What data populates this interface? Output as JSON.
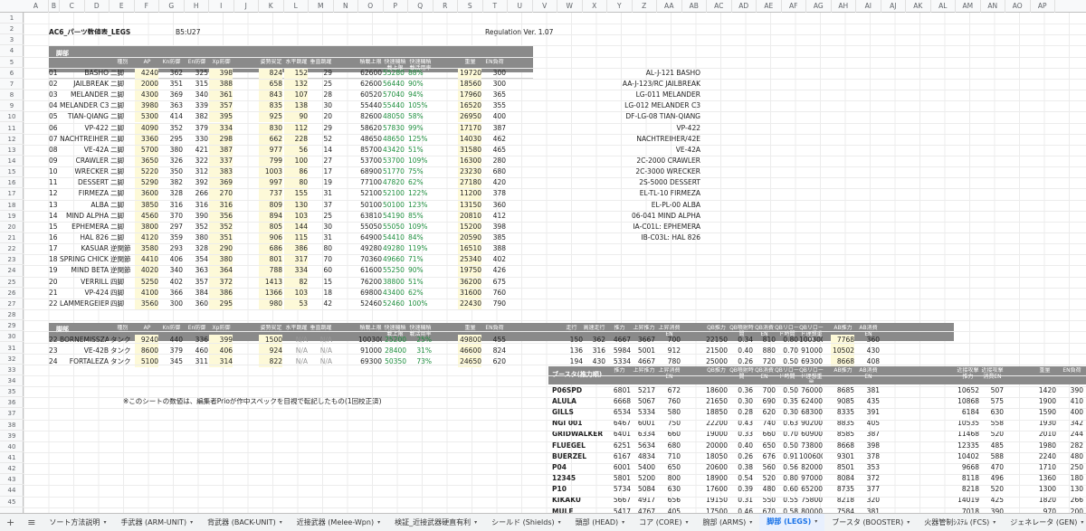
{
  "columns": [
    "A",
    "B",
    "C",
    "D",
    "E",
    "F",
    "G",
    "H",
    "I",
    "J",
    "K",
    "L",
    "M",
    "N",
    "O",
    "P",
    "Q",
    "R",
    "S",
    "T",
    "U",
    "V",
    "W",
    "X",
    "Y",
    "Z",
    "AA",
    "AB",
    "AC",
    "AD",
    "AE",
    "AF",
    "AG",
    "AH",
    "AI",
    "AJ",
    "AK",
    "AL",
    "AM",
    "AN",
    "AO",
    "AP"
  ],
  "rows": [
    "1",
    "2",
    "3",
    "4",
    "5",
    "6",
    "7",
    "8",
    "9",
    "10",
    "11",
    "12",
    "13",
    "14",
    "15",
    "16",
    "17",
    "18",
    "19",
    "20",
    "21",
    "22",
    "23",
    "24",
    "25",
    "26",
    "27",
    "28",
    "29",
    "30",
    "31",
    "32",
    "33",
    "34",
    "35",
    "36",
    "37",
    "38",
    "39",
    "40",
    "41",
    "42",
    "43",
    "44",
    "45"
  ],
  "title": "AC6_パーツ数値表_LEGS",
  "range": "B5:U27",
  "regulation": "Regulation Ver. 1.07",
  "section1": {
    "label": "脚部",
    "headers": [
      "種別",
      "AP",
      "Kn防御",
      "En防御",
      "Xp防御",
      "姿勢安定",
      "水平跳躍",
      "垂直跳躍",
      "積載上限",
      "快速機積載上限",
      "快速機積載活用率",
      "重量",
      "EN負荷"
    ]
  },
  "legs": [
    [
      "01",
      "BASHO",
      "二脚",
      "4240",
      "362",
      "325",
      "398",
      "824",
      "152",
      "29",
      "62600",
      "55280",
      "88%",
      "19720",
      "300",
      "AL-J-121 BASHO"
    ],
    [
      "02",
      "JAILBREAK",
      "二脚",
      "2000",
      "351",
      "315",
      "388",
      "658",
      "132",
      "25",
      "62600",
      "56440",
      "90%",
      "18560",
      "300",
      "AA-J-123/RC JAILBREAK"
    ],
    [
      "03",
      "MELANDER",
      "二脚",
      "4300",
      "369",
      "340",
      "361",
      "843",
      "107",
      "28",
      "60520",
      "57040",
      "94%",
      "17960",
      "365",
      "LG-011 MELANDER"
    ],
    [
      "04",
      "MELANDER C3",
      "二脚",
      "3980",
      "363",
      "339",
      "357",
      "835",
      "138",
      "30",
      "55440",
      "55440",
      "105%",
      "16520",
      "355",
      "LG-012 MELANDER C3"
    ],
    [
      "05",
      "TIAN-QIANG",
      "二脚",
      "5300",
      "414",
      "382",
      "395",
      "925",
      "90",
      "20",
      "82600",
      "48050",
      "58%",
      "26950",
      "400",
      "DF-LG-08 TIAN-QIANG"
    ],
    [
      "06",
      "VP-422",
      "二脚",
      "4090",
      "352",
      "379",
      "334",
      "830",
      "112",
      "29",
      "58620",
      "57830",
      "99%",
      "17170",
      "387",
      "VP-422"
    ],
    [
      "07",
      "NACHTREIHER",
      "二脚",
      "3360",
      "295",
      "330",
      "298",
      "662",
      "228",
      "52",
      "48650",
      "48650",
      "125%",
      "14030",
      "462",
      "NACHTREIHER/42E"
    ],
    [
      "08",
      "VE-42A",
      "二脚",
      "5700",
      "380",
      "421",
      "387",
      "977",
      "56",
      "14",
      "85700",
      "43420",
      "51%",
      "31580",
      "465",
      "VE-42A"
    ],
    [
      "09",
      "CRAWLER",
      "二脚",
      "3650",
      "326",
      "322",
      "337",
      "799",
      "100",
      "27",
      "53700",
      "53700",
      "109%",
      "16300",
      "280",
      "2C-2000 CRAWLER"
    ],
    [
      "10",
      "WRECKER",
      "二脚",
      "5220",
      "350",
      "312",
      "383",
      "1003",
      "86",
      "17",
      "68900",
      "51770",
      "75%",
      "23230",
      "680",
      "2C-3000 WRECKER"
    ],
    [
      "11",
      "DESSERT",
      "二脚",
      "5290",
      "382",
      "392",
      "369",
      "997",
      "80",
      "19",
      "77100",
      "47820",
      "62%",
      "27180",
      "420",
      "2S-5000 DESSERT"
    ],
    [
      "12",
      "FIRMEZA",
      "二脚",
      "3600",
      "328",
      "266",
      "270",
      "737",
      "155",
      "31",
      "52100",
      "52100",
      "122%",
      "11200",
      "378",
      "EL-TL-10 FIRMEZA"
    ],
    [
      "13",
      "ALBA",
      "二脚",
      "3850",
      "316",
      "316",
      "316",
      "809",
      "130",
      "37",
      "50100",
      "50100",
      "123%",
      "13150",
      "360",
      "EL-PL-00 ALBA"
    ],
    [
      "14",
      "MIND ALPHA",
      "二脚",
      "4560",
      "370",
      "390",
      "356",
      "894",
      "103",
      "25",
      "63810",
      "54190",
      "85%",
      "20810",
      "412",
      "06-041 MIND ALPHA"
    ],
    [
      "15",
      "EPHEMERA",
      "二脚",
      "3800",
      "297",
      "352",
      "352",
      "805",
      "144",
      "30",
      "55050",
      "55050",
      "109%",
      "15200",
      "398",
      "IA-C01L: EPHEMERA"
    ],
    [
      "16",
      "HAL 826",
      "二脚",
      "4120",
      "359",
      "380",
      "351",
      "906",
      "115",
      "31",
      "64900",
      "54410",
      "84%",
      "20590",
      "385",
      "IB-C03L: HAL 826"
    ],
    [
      "17",
      "KASUAR",
      "逆関節",
      "3580",
      "293",
      "328",
      "290",
      "686",
      "386",
      "80",
      "49280",
      "49280",
      "119%",
      "16510",
      "388",
      ""
    ],
    [
      "18",
      "SPRING CHICKEN",
      "逆関節",
      "4410",
      "406",
      "354",
      "380",
      "801",
      "317",
      "70",
      "70360",
      "49660",
      "71%",
      "25340",
      "402",
      ""
    ],
    [
      "19",
      "MIND BETA",
      "逆関節",
      "4020",
      "340",
      "363",
      "364",
      "788",
      "334",
      "60",
      "61600",
      "55250",
      "90%",
      "19750",
      "426",
      ""
    ],
    [
      "20",
      "VERRILL",
      "四脚",
      "5250",
      "402",
      "357",
      "372",
      "1413",
      "82",
      "15",
      "76200",
      "38800",
      "51%",
      "36200",
      "675",
      ""
    ],
    [
      "21",
      "VP-424",
      "四脚",
      "4100",
      "366",
      "384",
      "386",
      "1366",
      "103",
      "18",
      "69800",
      "43400",
      "62%",
      "31600",
      "760",
      ""
    ],
    [
      "22",
      "LAMMERGEIER",
      "四脚",
      "3560",
      "300",
      "360",
      "295",
      "980",
      "53",
      "42",
      "52460",
      "52460",
      "100%",
      "22430",
      "790",
      ""
    ]
  ],
  "section2": {
    "label": "脚部",
    "headers": [
      "種別",
      "AP",
      "Kn防御",
      "En防御",
      "Xp防御",
      "姿勢安定",
      "水平跳躍",
      "垂直跳躍",
      "積載上限",
      "快速機積載上限",
      "快速機積載活用率",
      "重量",
      "EN負荷"
    ],
    "extra_headers": [
      "走行",
      "高速走行",
      "推力",
      "上昇推力",
      "上昇消費EN",
      "QB推力",
      "QB噴射時間",
      "QB消費EN",
      "QBリロード時間",
      "QBリロード理想重量",
      "AB推力",
      "AB消費EN"
    ]
  },
  "tanks": [
    [
      "22",
      "BORNEMISSZA",
      "タンク",
      "9240",
      "440",
      "336",
      "399",
      "1500",
      "N/A",
      "N/A",
      "100300",
      "25200",
      "25%",
      "49800",
      "455",
      "150",
      "362",
      "4667",
      "3667",
      "700",
      "22150",
      "0.34",
      "810",
      "0.80",
      "100300",
      "7768",
      "360"
    ],
    [
      "23",
      "VE-42B",
      "タンク",
      "8600",
      "379",
      "460",
      "406",
      "924",
      "N/A",
      "N/A",
      "91000",
      "28400",
      "31%",
      "46600",
      "824",
      "136",
      "316",
      "5984",
      "5001",
      "912",
      "21500",
      "0.40",
      "880",
      "0.70",
      "91000",
      "10502",
      "430"
    ],
    [
      "24",
      "FORTALEZA",
      "タンク",
      "5100",
      "345",
      "311",
      "314",
      "822",
      "N/A",
      "N/A",
      "69300",
      "50350",
      "73%",
      "24650",
      "620",
      "194",
      "430",
      "5334",
      "4667",
      "780",
      "25000",
      "0.26",
      "720",
      "0.50",
      "69300",
      "8668",
      "408"
    ]
  ],
  "note": "※このシートの数値は、編集者Prioが作中スペックを目視で転記したもの(1回校正済)",
  "booster": {
    "label": "ブースタ(推力順)",
    "headers": [
      "推力",
      "上昇推力",
      "上昇消費EN",
      "QB推力",
      "QB噴射時間",
      "QB消費EN",
      "QBリロード時間",
      "QBリロード理想重量",
      "AB推力",
      "AB消費EN",
      "近接攻撃推力",
      "近接攻撃消費EN",
      "重量",
      "EN負荷"
    ],
    "rows": [
      [
        "P06SPD",
        "6801",
        "5217",
        "672",
        "18600",
        "0.36",
        "700",
        "0.50",
        "76000",
        "8685",
        "381",
        "10652",
        "507",
        "1420",
        "390"
      ],
      [
        "ALULA",
        "6668",
        "5067",
        "760",
        "21650",
        "0.30",
        "690",
        "0.35",
        "62400",
        "9085",
        "435",
        "10868",
        "575",
        "1900",
        "410"
      ],
      [
        "GILLS",
        "6534",
        "5334",
        "580",
        "18850",
        "0.28",
        "620",
        "0.30",
        "68300",
        "8335",
        "391",
        "6184",
        "630",
        "1590",
        "400"
      ],
      [
        "NGI 001",
        "6467",
        "6001",
        "750",
        "22200",
        "0.43",
        "740",
        "0.63",
        "90200",
        "8835",
        "405",
        "10535",
        "558",
        "1930",
        "342"
      ],
      [
        "GRIDWALKER",
        "6401",
        "6334",
        "660",
        "19000",
        "0.33",
        "660",
        "0.70",
        "60900",
        "8585",
        "387",
        "11468",
        "520",
        "2010",
        "244"
      ],
      [
        "FLUEGEL",
        "6251",
        "5634",
        "680",
        "20000",
        "0.40",
        "650",
        "0.50",
        "73800",
        "8668",
        "398",
        "12335",
        "485",
        "1980",
        "282"
      ],
      [
        "BUERZEL",
        "6167",
        "4834",
        "710",
        "18050",
        "0.26",
        "676",
        "0.91",
        "100600",
        "9301",
        "378",
        "10402",
        "588",
        "2240",
        "480"
      ],
      [
        "P04",
        "6001",
        "5400",
        "650",
        "20600",
        "0.38",
        "560",
        "0.56",
        "82000",
        "8501",
        "353",
        "9668",
        "470",
        "1710",
        "250"
      ],
      [
        "12345",
        "5801",
        "5200",
        "800",
        "18900",
        "0.54",
        "520",
        "0.80",
        "97000",
        "8084",
        "372",
        "8118",
        "496",
        "1360",
        "180"
      ],
      [
        "P10",
        "5734",
        "5084",
        "630",
        "17600",
        "0.39",
        "480",
        "0.60",
        "65200",
        "8735",
        "377",
        "8218",
        "520",
        "1300",
        "130"
      ],
      [
        "KIKAKU",
        "5667",
        "4917",
        "656",
        "19150",
        "0.31",
        "550",
        "0.55",
        "75800",
        "8218",
        "320",
        "14019",
        "425",
        "1820",
        "266"
      ],
      [
        "MULE",
        "5417",
        "4767",
        "405",
        "17500",
        "0.46",
        "670",
        "0.58",
        "80000",
        "7584",
        "381",
        "7018",
        "390",
        "970",
        "200"
      ]
    ]
  },
  "tabs": [
    "ソート方法説明",
    "手武器 (ARM-UNIT)",
    "背武器 (BACK-UNIT)",
    "近接武器 (Melee-Wpn)",
    "検証_近接武器硬直有利",
    "シールド (Shields)",
    "頭部 (HEAD)",
    "コア (CORE)",
    "腕部 (ARMS)",
    "脚部 (LEGS)",
    "ブースタ (BOOSTER)",
    "火器管制ｼｽﾃﾑ (FCS)",
    "ジェネレータ (GEN)"
  ],
  "active_tab": "脚部 (LEGS)",
  "colors": {
    "header_band": "#8a8a8a",
    "highlight": "#fdf9d8",
    "link": "#1a57b8",
    "active_tab": "#1a73e8"
  }
}
